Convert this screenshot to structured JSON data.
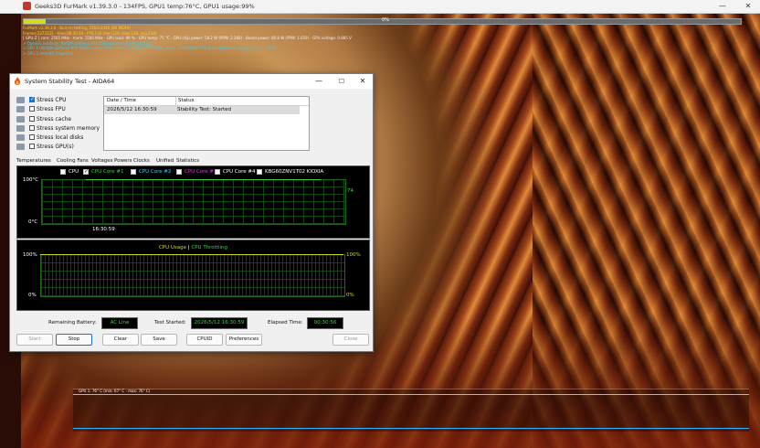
{
  "furmark": {
    "title": "Geeks3D FurMark v1.39.3.0 - 134FPS, GPU1 temp:76°C, GPU1 usage:99%",
    "minimize": "—",
    "close": "✕",
    "progress_label": "0%",
    "progress_fraction": 0.03,
    "overlay_lines": [
      {
        "text": "FurMark v1.39.3.0 - Burn-in testing, 2560x1440 (0X MSAA)",
        "color": "yellow"
      },
      {
        "text": "Frames:2273121 - time:06:30:19 - FPS:134 (min:129, max:139, avg:134)",
        "color": "yellow"
      },
      {
        "text": "[ GPU-Z ] core: 2505 MHz - mem: 1500 MHz - GPU load: 99 % - GPU temp: 75 °C - GPU chip power: 58.2 W (PPW: 2.268) - Board power: 80.8 W (PPW: 1.659) - GPU voltage: 0.895 V",
        "color": "white"
      },
      {
        "text": "> OpenGL renderer: NVIDIA GeForce RTX 5060 Laptop GPU/PCIe/SSE2",
        "color": "cyan"
      },
      {
        "text": "> GPU 1 (NVIDIA GeForce RTX 5060 Laptop GPU) - core: 2505MHz/75°C/99%, mem: 11000MHz/15%, limits:[power:0, temp:0, volt:1, OV:0]",
        "color": "cyan"
      },
      {
        "text": "> GPU 2 (Intel(R) Graphics)",
        "color": "cyan"
      }
    ],
    "graph_label": "GPU 1: 76° C (min: 67° C - max: 76° C)"
  },
  "dialog": {
    "title": "System Stability Test - AIDA64",
    "minimize": "—",
    "maximize": "☐",
    "close": "✕",
    "stress_items": [
      {
        "label": "Stress CPU",
        "checked": true,
        "icon": "cpu-icon"
      },
      {
        "label": "Stress FPU",
        "checked": false,
        "icon": "fpu-icon"
      },
      {
        "label": "Stress cache",
        "checked": false,
        "icon": "cache-icon"
      },
      {
        "label": "Stress system memory",
        "checked": false,
        "icon": "memory-icon"
      },
      {
        "label": "Stress local disks",
        "checked": false,
        "icon": "disk-icon"
      },
      {
        "label": "Stress GPU(s)",
        "checked": false,
        "icon": "gpu-icon"
      }
    ],
    "log": {
      "headers": [
        "Date / Time",
        "Status"
      ],
      "rows": [
        {
          "datetime": "2026/5/12 16:30:59",
          "status": "Stability Test: Started"
        }
      ]
    },
    "tabs": [
      "Temperatures",
      "Cooling Fans",
      "Voltages",
      "Powers",
      "Clocks",
      "Unified",
      "Statistics"
    ],
    "temp_graph": {
      "legend": [
        {
          "label": "CPU",
          "checked": false,
          "color": "#ffffff"
        },
        {
          "label": "CPU Core #1",
          "checked": true,
          "color": "#3cd43c"
        },
        {
          "label": "CPU Core #2",
          "checked": false,
          "color": "#35d0ff"
        },
        {
          "label": "CPU Core #3",
          "checked": false,
          "color": "#e040e0"
        },
        {
          "label": "CPU Core #4",
          "checked": false,
          "color": "#ffffff"
        },
        {
          "label": "KBG60ZNV1T02 KIOXIA",
          "checked": false,
          "color": "#ffffff"
        }
      ],
      "y_max": "100°C",
      "y_min": "0°C",
      "current_value": "74",
      "time_label": "16:30:59"
    },
    "cpu_graph": {
      "legend_usage": "CPU Usage",
      "legend_sep": "|",
      "legend_throttling": "CPU Throttling",
      "y_max_left": "100%",
      "y_min_left": "0%",
      "y_max_right": "100%",
      "y_min_right": "0%"
    },
    "status": {
      "battery_label": "Remaining Battery:",
      "battery_value": "AC Line",
      "started_label": "Test Started:",
      "started_value": "2026/5/12 16:30:59",
      "elapsed_label": "Elapsed Time:",
      "elapsed_value": "00:30:56"
    },
    "buttons": {
      "start": "Start",
      "stop": "Stop",
      "clear": "Clear",
      "save": "Save",
      "cpuid": "CPUID",
      "preferences": "Preferences",
      "close": "Close"
    }
  }
}
